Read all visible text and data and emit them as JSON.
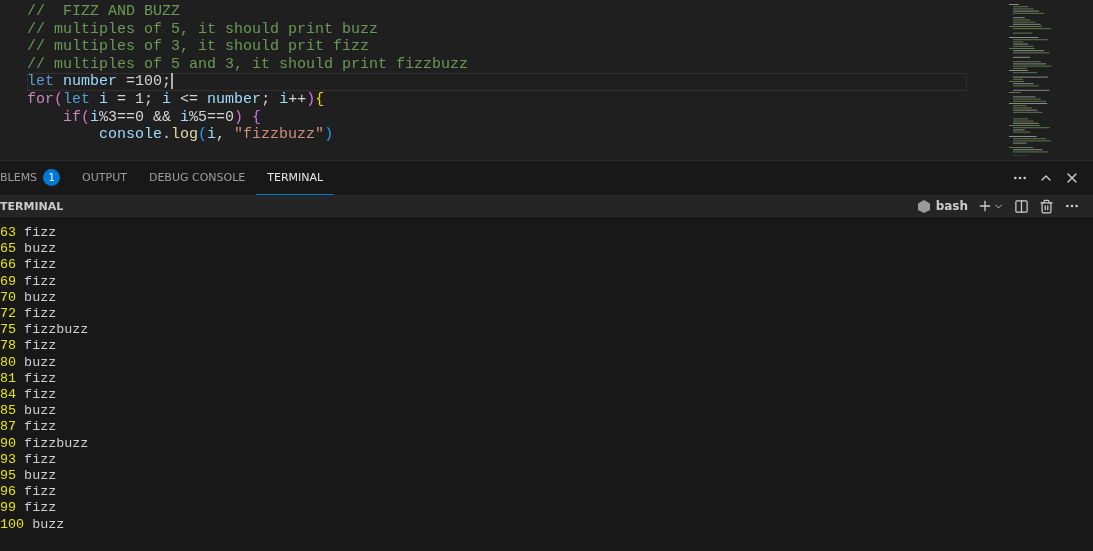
{
  "editor": {
    "lines": [
      {
        "current": false,
        "tokens": [
          {
            "kind": "comment",
            "text": "//  FIZZ AND BUZZ"
          }
        ]
      },
      {
        "current": false,
        "tokens": [
          {
            "kind": "comment",
            "text": "// multiples of 5, it should print buzz"
          }
        ]
      },
      {
        "current": false,
        "tokens": [
          {
            "kind": "comment",
            "text": "// multiples of 3, it should prit fizz"
          }
        ]
      },
      {
        "current": false,
        "tokens": [
          {
            "kind": "comment",
            "text": "// multiples of 5 and 3, it should print fizzbuzz"
          }
        ]
      },
      {
        "current": true,
        "tokens": [
          {
            "kind": "keyword",
            "text": "let "
          },
          {
            "kind": "variable",
            "text": "number"
          },
          {
            "kind": "plain",
            "text": " =100;"
          }
        ]
      },
      {
        "current": false,
        "tokens": [
          {
            "kind": "control",
            "text": "for"
          },
          {
            "kind": "bracket1",
            "text": "("
          },
          {
            "kind": "keyword",
            "text": "let "
          },
          {
            "kind": "variable",
            "text": "i"
          },
          {
            "kind": "plain",
            "text": " = 1; "
          },
          {
            "kind": "variable",
            "text": "i"
          },
          {
            "kind": "plain",
            "text": " <= "
          },
          {
            "kind": "variable",
            "text": "number"
          },
          {
            "kind": "plain",
            "text": "; "
          },
          {
            "kind": "variable",
            "text": "i"
          },
          {
            "kind": "plain",
            "text": "++"
          },
          {
            "kind": "bracket1",
            "text": ")"
          },
          {
            "kind": "bracket0",
            "text": "{"
          }
        ]
      },
      {
        "current": false,
        "tokens": [
          {
            "kind": "control",
            "text": "    if"
          },
          {
            "kind": "bracket1",
            "text": "("
          },
          {
            "kind": "variable",
            "text": "i"
          },
          {
            "kind": "plain",
            "text": "%3==0 && "
          },
          {
            "kind": "variable",
            "text": "i"
          },
          {
            "kind": "plain",
            "text": "%5==0"
          },
          {
            "kind": "bracket1",
            "text": ") {"
          }
        ]
      },
      {
        "current": false,
        "tokens": [
          {
            "kind": "variable",
            "text": "        console"
          },
          {
            "kind": "plain",
            "text": "."
          },
          {
            "kind": "function",
            "text": "log"
          },
          {
            "kind": "bracket2",
            "text": "("
          },
          {
            "kind": "variable",
            "text": "i"
          },
          {
            "kind": "plain",
            "text": ", "
          },
          {
            "kind": "string",
            "text": "\"fizzbuzz\""
          },
          {
            "kind": "bracket2",
            "text": ")"
          }
        ]
      }
    ]
  },
  "panel": {
    "tabs": [
      {
        "label": "BLEMS",
        "badge": "1",
        "selected": false
      },
      {
        "label": "OUTPUT",
        "selected": false
      },
      {
        "label": "DEBUG CONSOLE",
        "selected": false
      },
      {
        "label": "TERMINAL",
        "selected": true
      }
    ],
    "header": "TERMINAL",
    "shell": "bash"
  },
  "terminal": {
    "lines": [
      {
        "number": "63",
        "word": "fizz"
      },
      {
        "number": "65",
        "word": "buzz"
      },
      {
        "number": "66",
        "word": "fizz"
      },
      {
        "number": "69",
        "word": "fizz"
      },
      {
        "number": "70",
        "word": "buzz"
      },
      {
        "number": "72",
        "word": "fizz"
      },
      {
        "number": "75",
        "word": "fizzbuzz"
      },
      {
        "number": "78",
        "word": "fizz"
      },
      {
        "number": "80",
        "word": "buzz"
      },
      {
        "number": "81",
        "word": "fizz"
      },
      {
        "number": "84",
        "word": "fizz"
      },
      {
        "number": "85",
        "word": "buzz"
      },
      {
        "number": "87",
        "word": "fizz"
      },
      {
        "number": "90",
        "word": "fizzbuzz"
      },
      {
        "number": "93",
        "word": "fizz"
      },
      {
        "number": "95",
        "word": "buzz"
      },
      {
        "number": "96",
        "word": "fizz"
      },
      {
        "number": "99",
        "word": "fizz"
      },
      {
        "number": "100",
        "word": "buzz"
      }
    ]
  }
}
